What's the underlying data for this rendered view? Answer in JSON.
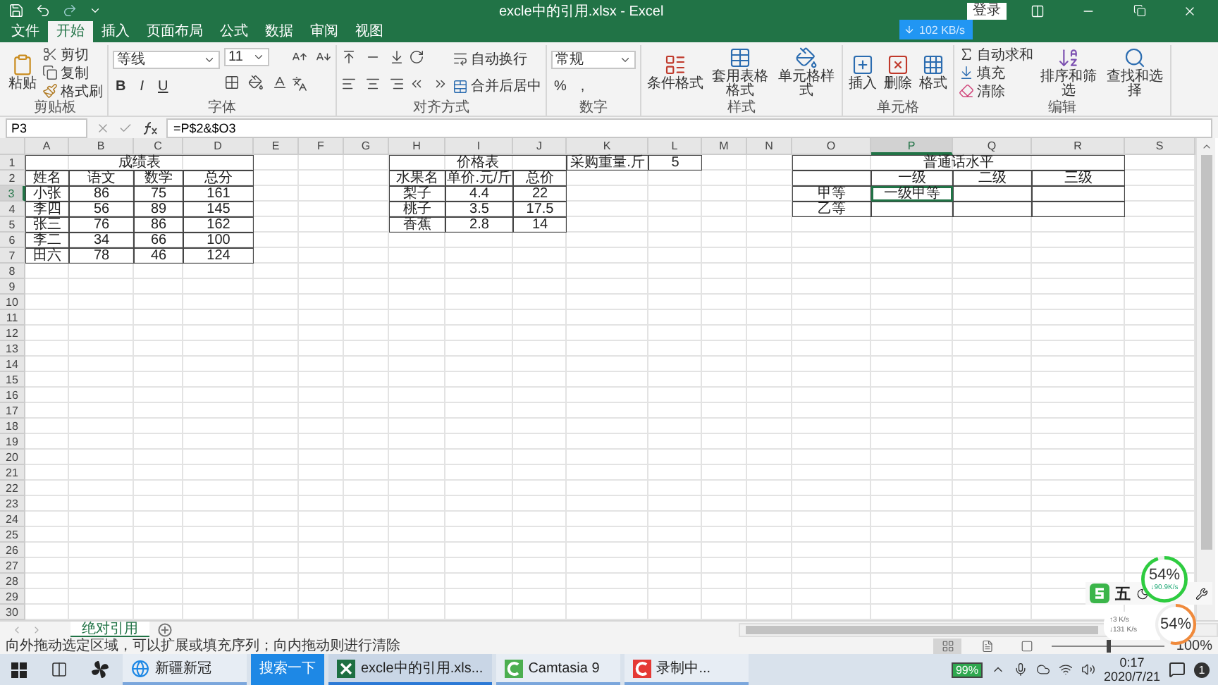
{
  "window": {
    "title": "excle中的引用.xlsx - Excel",
    "sign_in": "登录"
  },
  "menu_tabs": [
    {
      "label": "文件",
      "selected": false
    },
    {
      "label": "开始",
      "selected": true
    },
    {
      "label": "插入",
      "selected": false
    },
    {
      "label": "页面布局",
      "selected": false
    },
    {
      "label": "公式",
      "selected": false
    },
    {
      "label": "数据",
      "selected": false
    },
    {
      "label": "审阅",
      "selected": false
    },
    {
      "label": "视图",
      "selected": false
    }
  ],
  "ribbon": {
    "groups": [
      {
        "label": "剪贴板",
        "columns": [
          [
            {
              "kind": "large",
              "label": "粘贴"
            }
          ],
          [
            {
              "kind": "small",
              "label": "剪切"
            },
            {
              "kind": "small",
              "label": "复制"
            },
            {
              "kind": "small",
              "label": "格式刷"
            }
          ]
        ]
      },
      {
        "label": "字体",
        "columns": [
          [
            {
              "kind": "select",
              "value": "等线"
            },
            {
              "kind": "buttons",
              "labels": [
                "B",
                "I",
                "U"
              ]
            }
          ],
          [
            {
              "kind": "select",
              "value": "11"
            },
            {
              "kind": "icons"
            }
          ],
          [
            {
              "kind": "icons"
            },
            {
              "kind": "icons"
            }
          ]
        ]
      },
      {
        "label": "对齐方式",
        "columns": [
          [
            {
              "kind": "icons"
            },
            {
              "kind": "icons"
            }
          ],
          [
            {
              "kind": "icons"
            },
            {
              "kind": "icons"
            }
          ],
          [
            {
              "kind": "small",
              "label": "自动换行"
            },
            {
              "kind": "small",
              "label": "合并后居中"
            }
          ]
        ]
      },
      {
        "label": "数字",
        "columns": [
          [
            {
              "kind": "select",
              "value": "常规"
            },
            {
              "kind": "buttons",
              "labels": [
                "%",
                ","
              ]
            }
          ]
        ]
      },
      {
        "label": "样式",
        "columns": [
          [
            {
              "kind": "large",
              "label": "条件格式"
            }
          ],
          [
            {
              "kind": "large",
              "label": "套用表格格式"
            }
          ],
          [
            {
              "kind": "large",
              "label": "单元格样式"
            }
          ]
        ]
      },
      {
        "label": "单元格",
        "columns": [
          [
            {
              "kind": "large",
              "label": "插入"
            }
          ],
          [
            {
              "kind": "large",
              "label": "删除"
            }
          ],
          [
            {
              "kind": "large",
              "label": "格式"
            }
          ]
        ]
      },
      {
        "label": "编辑",
        "columns": [
          [
            {
              "kind": "small",
              "label": "自动求和"
            },
            {
              "kind": "small",
              "label": "填充"
            },
            {
              "kind": "small",
              "label": "清除"
            }
          ],
          [
            {
              "kind": "large",
              "label": "排序和筛选"
            }
          ],
          [
            {
              "kind": "large",
              "label": "查找和选择"
            }
          ]
        ]
      }
    ]
  },
  "formula_bar": {
    "name_box": "P3",
    "formula": "=P$2&$O3"
  },
  "sheet": {
    "columns": [
      {
        "label": "A",
        "selected": false
      },
      {
        "label": "B",
        "selected": false
      },
      {
        "label": "C",
        "selected": false
      },
      {
        "label": "D",
        "selected": false
      },
      {
        "label": "E",
        "selected": false
      },
      {
        "label": "F",
        "selected": false
      },
      {
        "label": "G",
        "selected": false
      },
      {
        "label": "H",
        "selected": false
      },
      {
        "label": "I",
        "selected": false
      },
      {
        "label": "J",
        "selected": false
      },
      {
        "label": "K",
        "selected": false
      },
      {
        "label": "L",
        "selected": false
      },
      {
        "label": "M",
        "selected": false
      },
      {
        "label": "N",
        "selected": false
      },
      {
        "label": "O",
        "selected": false
      },
      {
        "label": "P",
        "selected": true
      },
      {
        "label": "Q",
        "selected": false
      },
      {
        "label": "R",
        "selected": false
      },
      {
        "label": "S",
        "selected": false
      }
    ],
    "rows": [
      {
        "number": "1",
        "selected": false,
        "cells": [
          {
            "text": "成绩表",
            "bordered": true
          },
          {
            "merged": true
          },
          {
            "merged": true
          },
          {
            "merged": true
          },
          {},
          {},
          {},
          {
            "text": "价格表",
            "bordered": true
          },
          {
            "merged": true
          },
          {
            "merged": true
          },
          {
            "text": "采购重量.斤",
            "bordered": true
          },
          {
            "text": "5",
            "bordered": true
          },
          {},
          {},
          {
            "text": "普通话水平",
            "bordered": true
          },
          {
            "merged": true
          },
          {
            "merged": true
          },
          {
            "merged": true
          }
        ]
      },
      {
        "number": "2",
        "selected": false,
        "cells": [
          {
            "text": "姓名",
            "bordered": true
          },
          {
            "text": "语文",
            "bordered": true
          },
          {
            "text": "数学",
            "bordered": true
          },
          {
            "text": "总分",
            "bordered": true
          },
          {},
          {},
          {},
          {
            "text": "水果名",
            "bordered": true
          },
          {
            "text": "单价.元/斤",
            "bordered": true
          },
          {
            "text": "总价",
            "bordered": true
          },
          {},
          {},
          {},
          {},
          {
            "bordered": true
          },
          {
            "text": "一级",
            "bordered": true
          },
          {
            "text": "二级",
            "bordered": true
          },
          {
            "text": "三级",
            "bordered": true
          }
        ]
      },
      {
        "number": "3",
        "selected": true,
        "cells": [
          {
            "text": "小张",
            "bordered": true
          },
          {
            "text": "86",
            "bordered": true
          },
          {
            "text": "75",
            "bordered": true
          },
          {
            "text": "161",
            "bordered": true
          },
          {},
          {},
          {},
          {
            "text": "梨子",
            "bordered": true
          },
          {
            "text": "4.4",
            "bordered": true
          },
          {
            "text": "22",
            "bordered": true
          },
          {},
          {},
          {},
          {},
          {
            "text": "甲等",
            "bordered": true
          },
          {
            "text": "一级甲等",
            "bordered": true
          },
          {
            "bordered": true
          },
          {
            "bordered": true
          }
        ]
      },
      {
        "number": "4",
        "selected": false,
        "cells": [
          {
            "text": "李四",
            "bordered": true
          },
          {
            "text": "56",
            "bordered": true
          },
          {
            "text": "89",
            "bordered": true
          },
          {
            "text": "145",
            "bordered": true
          },
          {},
          {},
          {},
          {
            "text": "桃子",
            "bordered": true
          },
          {
            "text": "3.5",
            "bordered": true
          },
          {
            "text": "17.5",
            "bordered": true
          },
          {},
          {},
          {},
          {},
          {
            "text": "乙等",
            "bordered": true
          },
          {
            "bordered": true
          },
          {
            "bordered": true
          },
          {
            "bordered": true
          }
        ]
      },
      {
        "number": "5",
        "selected": false,
        "cells": [
          {
            "text": "张三",
            "bordered": true
          },
          {
            "text": "76",
            "bordered": true
          },
          {
            "text": "86",
            "bordered": true
          },
          {
            "text": "162",
            "bordered": true
          },
          {},
          {},
          {},
          {
            "text": "香蕉",
            "bordered": true
          },
          {
            "text": "2.8",
            "bordered": true
          },
          {
            "text": "14",
            "bordered": true
          }
        ]
      },
      {
        "number": "6",
        "selected": false,
        "cells": [
          {
            "text": "李二",
            "bordered": true
          },
          {
            "text": "34",
            "bordered": true
          },
          {
            "text": "66",
            "bordered": true
          },
          {
            "text": "100",
            "bordered": true
          }
        ]
      },
      {
        "number": "7",
        "selected": false,
        "cells": [
          {
            "text": "田六",
            "bordered": true
          },
          {
            "text": "78",
            "bordered": true
          },
          {
            "text": "46",
            "bordered": true
          },
          {
            "text": "124",
            "bordered": true
          }
        ]
      },
      {
        "number": "8",
        "selected": false
      },
      {
        "number": "9",
        "selected": false
      },
      {
        "number": "10",
        "selected": false
      },
      {
        "number": "11",
        "selected": false
      },
      {
        "number": "12",
        "selected": false
      },
      {
        "number": "13",
        "selected": false
      },
      {
        "number": "14",
        "selected": false
      },
      {
        "number": "15",
        "selected": false
      },
      {
        "number": "16",
        "selected": false
      },
      {
        "number": "17",
        "selected": false
      },
      {
        "number": "18",
        "selected": false
      },
      {
        "number": "19",
        "selected": false
      },
      {
        "number": "20",
        "selected": false
      },
      {
        "number": "21",
        "selected": false
      },
      {
        "number": "22",
        "selected": false
      },
      {
        "number": "23",
        "selected": false
      },
      {
        "number": "24",
        "selected": false
      },
      {
        "number": "25",
        "selected": false
      },
      {
        "number": "26",
        "selected": false
      },
      {
        "number": "27",
        "selected": false
      },
      {
        "number": "28",
        "selected": false
      },
      {
        "number": "29",
        "selected": false
      },
      {
        "number": "30",
        "selected": false
      }
    ]
  },
  "sheet_tabs": [
    {
      "label": "绝对引用",
      "selected": true
    }
  ],
  "status_bar": {
    "message": "向外拖动选定区域，可以扩展或填充序列；向内拖动则进行清除",
    "views": [
      {
        "selected": true
      },
      {
        "selected": false
      },
      {
        "selected": false
      }
    ],
    "zoom": {
      "level": 0.5,
      "label": "100%"
    }
  },
  "overlays": {
    "network_speed": "102 KB/s",
    "ime_mode": "五",
    "memory_widget": {
      "percent": "54%",
      "speed": "↓90.9K/s",
      "level": 0.95
    },
    "speed_widget": {
      "upload": "↑3 K/s",
      "download": "↓131 K/s",
      "percent": "54%",
      "level": 0.54
    }
  },
  "taskbar": {
    "items": [
      {
        "kind": "browser",
        "label": "新疆新冠",
        "selected": false
      },
      {
        "kind": "search",
        "label": "搜索一下",
        "selected": false
      },
      {
        "kind": "excel",
        "label": "excle中的引用.xls...",
        "selected": true
      },
      {
        "kind": "camtasia",
        "label": "Camtasia 9",
        "selected": false
      },
      {
        "kind": "recorder",
        "label": "录制中...",
        "selected": false
      }
    ],
    "battery": "99%",
    "time": "0:17",
    "date": "2020/7/21",
    "notifications": "1"
  }
}
